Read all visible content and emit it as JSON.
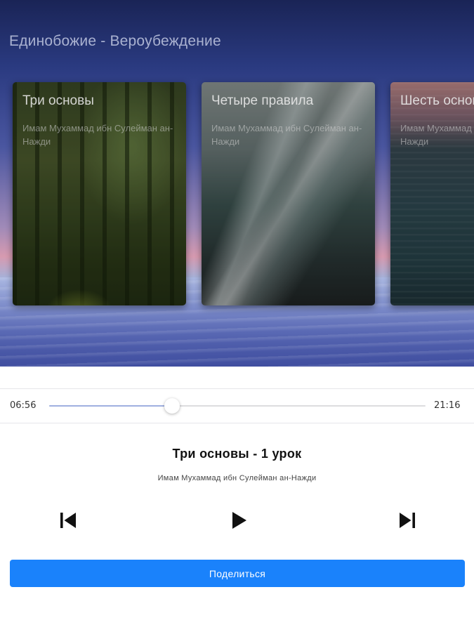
{
  "section": {
    "title": "Единобожие - Вероубеждение"
  },
  "cards": [
    {
      "title": "Три основы",
      "author": "Имам Мухаммад ибн Сулейман ан-Нажди"
    },
    {
      "title": "Четыре правила",
      "author": "Имам Мухаммад ибн Сулейман ан-Нажди"
    },
    {
      "title": "Шесть основ",
      "author": "Имам Мухаммад ибн Сулейман ан-Нажди"
    }
  ],
  "player": {
    "elapsed": "06:56",
    "duration": "21:16",
    "progress": 0.326,
    "track_title": "Три основы - 1 урок",
    "track_author": "Имам Мухаммад ибн Сулейман ан-Нажди",
    "icons": {
      "previous": "skip-previous-icon",
      "play": "play-icon",
      "next": "skip-next-icon"
    },
    "accent_color": "#1a82fb"
  },
  "share": {
    "label": "Поделиться"
  }
}
